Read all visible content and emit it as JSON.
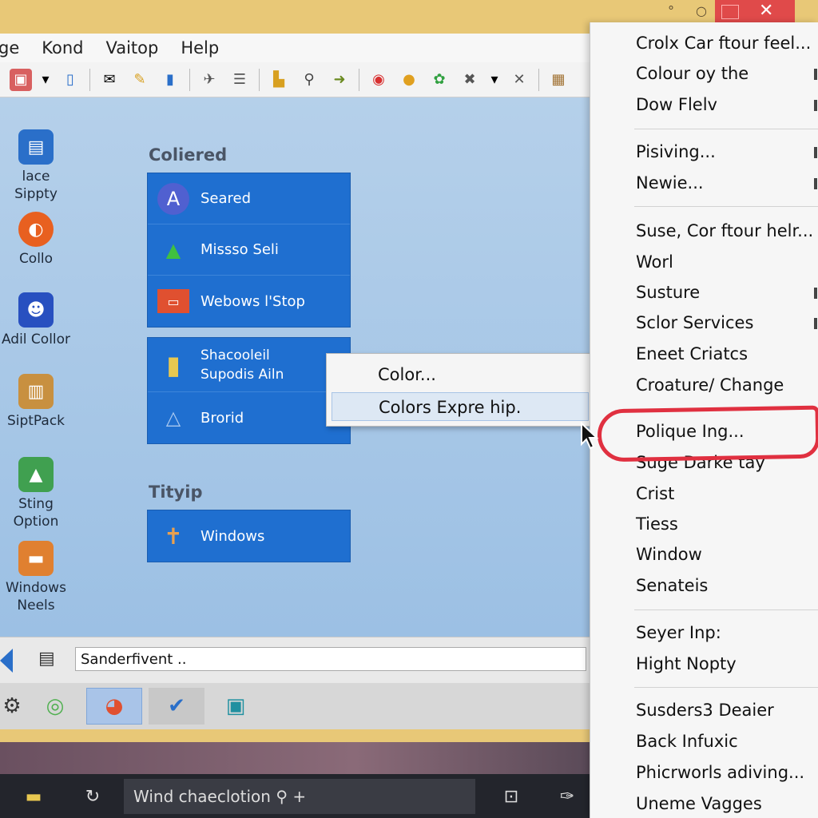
{
  "window": {
    "minimize_glyph": "°",
    "close_glyph": "✕"
  },
  "menubar": {
    "items": [
      "ge",
      "Kond",
      "Vaitop",
      "Help"
    ]
  },
  "toolbar": {
    "icons": [
      "image-icon",
      "dropdown-arrow-icon",
      "phone-icon",
      "mail-icon",
      "wand-icon",
      "device-icon",
      "plane-icon",
      "list-icon",
      "chart-icon",
      "magnifier-icon",
      "arrow-icon",
      "globe-icon",
      "coin-icon",
      "gear-green-icon",
      "cross-icon",
      "dropdown-arrow-icon",
      "x-icon",
      "picture-icon"
    ]
  },
  "desktop_icons": [
    {
      "label": "lace Sippty",
      "icon": "monitor-icon"
    },
    {
      "label": "Collo",
      "icon": "firefox-icon"
    },
    {
      "label": "Adil Collor",
      "icon": "people-icon"
    },
    {
      "label": "SiptPack",
      "icon": "package-icon"
    },
    {
      "label": "Sting Option",
      "icon": "bag-icon"
    },
    {
      "label": "Windows\nNeels",
      "icon": "box-icon"
    }
  ],
  "sections": [
    {
      "title": "Coliered",
      "items": [
        {
          "label": "Seared",
          "icon": "letter-a-icon"
        },
        {
          "label": "Missso Seli",
          "icon": "triangle-icon"
        },
        {
          "label": "Webows l'Stop",
          "icon": "store-icon"
        }
      ]
    },
    {
      "title": "",
      "items": [
        {
          "label": "Shacooleil\nSupodis Ailn",
          "icon": "folder-icon"
        },
        {
          "label": "Brorid",
          "icon": "triangle-outline-icon"
        }
      ]
    },
    {
      "title": "Tityip",
      "items": [
        {
          "label": "Windows",
          "icon": "tool-icon"
        }
      ]
    }
  ],
  "context_menu_small": {
    "items": [
      "Color...",
      "Colors Expre hip."
    ],
    "highlighted_index": 1
  },
  "address_bar": {
    "value": "Sanderfivent ..",
    "placeholder": ""
  },
  "taskbar": {
    "search_text": "Wind chaeclotion"
  },
  "big_menu": {
    "groups": [
      [
        "Crolx Car ftour feel...",
        "Colour oy the",
        "Dow Flelv"
      ],
      [
        "Pisiving...",
        "Newie..."
      ],
      [
        "Suse, Cor ftour helr...",
        "Worl",
        "Susture",
        "Sclor Services",
        "Eneet Criatcs",
        "Croature/ Change",
        "Polique Ing...",
        "Suge Darke tay",
        "Crist",
        "Tiess",
        "Window",
        "Senateis"
      ],
      [
        "Seyer Inp:",
        "Hight Nopty"
      ],
      [
        "Susders3 Deaier",
        "Back Infuxic",
        "Phicrworls adiving...",
        "Uneme Vagges"
      ]
    ],
    "circled_item": "Polique Ing...",
    "circle_color": "#e03040"
  },
  "colors": {
    "titlebar": "#e8c877",
    "panel_blue": "#1f6fd0",
    "close_red": "#e04a4a",
    "background_blue": "#a8c8e8"
  }
}
